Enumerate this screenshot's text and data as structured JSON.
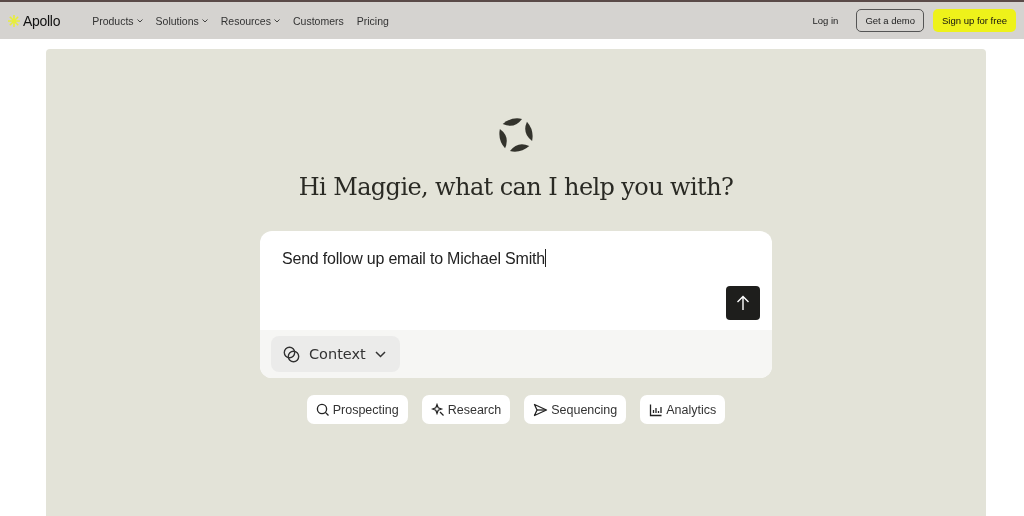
{
  "nav": {
    "brand": "Apollo",
    "links": [
      {
        "label": "Products",
        "has_menu": true
      },
      {
        "label": "Solutions",
        "has_menu": true
      },
      {
        "label": "Resources",
        "has_menu": true
      },
      {
        "label": "Customers",
        "has_menu": false
      },
      {
        "label": "Pricing",
        "has_menu": false
      }
    ],
    "actions": [
      {
        "label": "Log in",
        "kind": "text"
      },
      {
        "label": "Get a demo",
        "kind": "outline"
      },
      {
        "label": "Sign up for free",
        "kind": "primary"
      }
    ]
  },
  "hero": {
    "greeting": "Hi Maggie, what can I help you with?",
    "prompt": {
      "value": "Send follow up email to Michael Smith",
      "context_label": "Context"
    },
    "chips": [
      {
        "label": "Prospecting",
        "kind": "search"
      },
      {
        "label": "Research",
        "kind": "sparkle"
      },
      {
        "label": "Sequencing",
        "kind": "send"
      },
      {
        "label": "Analytics",
        "kind": "chart"
      }
    ]
  }
}
